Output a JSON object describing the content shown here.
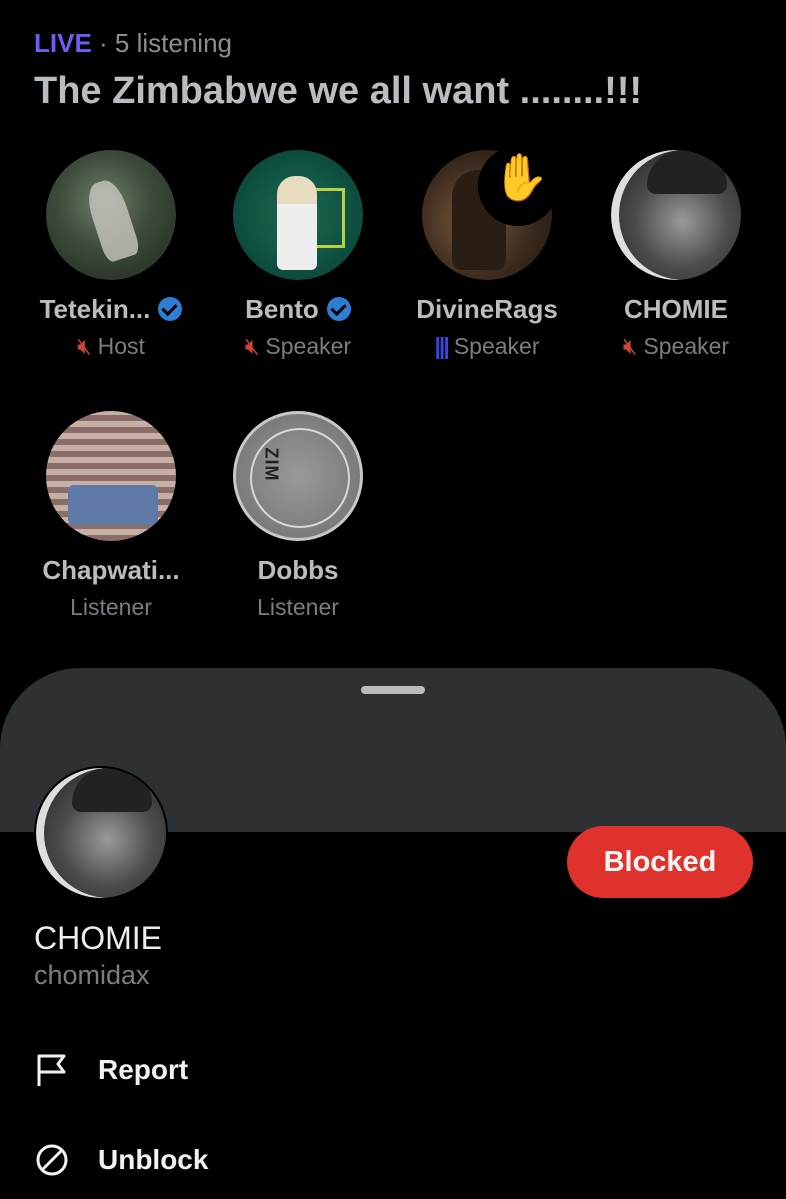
{
  "header": {
    "live_label": "LIVE",
    "listening": "· 5 listening",
    "title": "The Zimbabwe we all want ........!!!"
  },
  "participants": [
    {
      "name": "Tetekin...",
      "role": "Host",
      "verified": true,
      "status": "muted"
    },
    {
      "name": "Bento",
      "role": "Speaker",
      "verified": true,
      "status": "muted"
    },
    {
      "name": "DivineRags",
      "role": "Speaker",
      "verified": false,
      "status": "speaking",
      "hand_raised": true,
      "hand_emoji": "✋"
    },
    {
      "name": "CHOMIE",
      "role": "Speaker",
      "verified": false,
      "status": "muted"
    },
    {
      "name": "Chapwati...",
      "role": "Listener",
      "verified": false
    },
    {
      "name": "Dobbs",
      "role": "Listener",
      "verified": false,
      "avatar_text": "ZIM"
    }
  ],
  "sheet": {
    "user_name": "CHOMIE",
    "user_handle": "chomidax",
    "blocked_label": "Blocked",
    "menu": [
      {
        "label": "Report",
        "icon": "flag-icon"
      },
      {
        "label": "Unblock",
        "icon": "unblock-icon"
      }
    ]
  },
  "colors": {
    "live": "#6f5cf3",
    "muted": "#d0443a",
    "speaking": "#3846d9",
    "verified": "#2d7dd2",
    "blocked_button": "#e0322d",
    "sheet_background": "#2d3134"
  }
}
